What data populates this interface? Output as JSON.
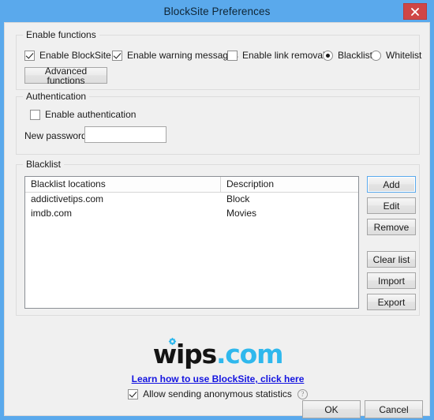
{
  "window": {
    "title": "BlockSite Preferences",
    "close_label": "×",
    "titlebar_color": "#5aa9ec",
    "close_button_color": "#cf4646"
  },
  "enable_functions": {
    "group_title": "Enable functions",
    "checkboxes": [
      {
        "label": "Enable BlockSite",
        "checked": true
      },
      {
        "label": "Enable warning messages",
        "checked": true
      },
      {
        "label": "Enable link removal",
        "checked": false
      }
    ],
    "radios": [
      {
        "label": "Blacklist",
        "checked": true
      },
      {
        "label": "Whitelist",
        "checked": false
      }
    ],
    "advanced_button": "Advanced functions"
  },
  "authentication": {
    "group_title": "Authentication",
    "enable_label": "Enable authentication",
    "enable_checked": false,
    "password_label": "New password",
    "password_value": "",
    "password_placeholder": ""
  },
  "blacklist": {
    "group_title": "Blacklist",
    "columns": [
      "Blacklist locations",
      "Description"
    ],
    "rows": [
      {
        "location": "addictivetips.com",
        "description": "Block"
      },
      {
        "location": "imdb.com",
        "description": "Movies"
      }
    ],
    "buttons": [
      {
        "label": "Add",
        "focused": true
      },
      {
        "label": "Edit",
        "focused": false
      },
      {
        "label": "Remove",
        "focused": false
      },
      {
        "label": "Clear list",
        "focused": false
      },
      {
        "label": "Import",
        "focused": false
      },
      {
        "label": "Export",
        "focused": false
      }
    ]
  },
  "footer": {
    "logo_dark": "wips",
    "logo_cyan": ".com",
    "logo_cyan_color": "#2fb8ed",
    "link_text": "Learn how to use BlockSite, click here",
    "link_color": "#1414e0",
    "stats_label": "Allow sending anonymous statistics",
    "stats_checked": true,
    "help_glyph": "?"
  },
  "dialog_buttons": {
    "ok": "OK",
    "cancel": "Cancel"
  }
}
